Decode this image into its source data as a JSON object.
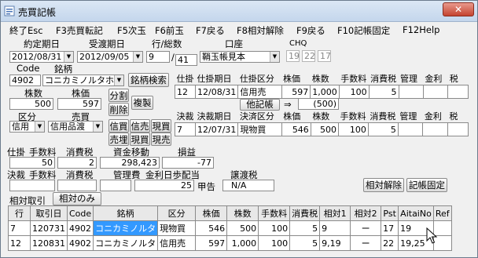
{
  "window": {
    "title": "売買記帳",
    "close_glyph": "✕"
  },
  "menu": [
    "終了Esc",
    "F3売買転記",
    "F5次玉",
    "F6前玉",
    "F7戻る",
    "F8相対解除",
    "F9戻る",
    "F10記帳固定",
    "F12Help"
  ],
  "top": {
    "contract_date_label": "約定期日",
    "contract_date": "2012/08/31",
    "delivery_date_label": "受渡期日",
    "delivery_date": "2012/09/05",
    "row_total_label": "行/総数",
    "row": "9",
    "total": "41",
    "account_label": "口座",
    "account": "鞘玉帳見本",
    "chq_label": "CHQ",
    "chq": [
      "19",
      "22",
      "17"
    ],
    "code_label": "Code",
    "code": "4902",
    "brand_label": "銘柄",
    "brand": "コニカミノルタホー",
    "brand_search_button": "銘柄検索"
  },
  "entry": {
    "shares_label": "株数",
    "shares": "500",
    "price_label": "株価",
    "price": "597",
    "split_button": "分割",
    "delete_button": "削除",
    "copy_button": "複製",
    "category_label": "区分",
    "category": "信用",
    "trade_label": "売買",
    "trade": "信用品渡",
    "btn_credit_buy": "信買",
    "btn_credit_sell": "信売",
    "btn_spot_buy": "現買",
    "btn_spot_sell_a": "売埋",
    "btn_spot_buy2": "現買",
    "btn_spot_sell": "現売"
  },
  "open_position": {
    "headers": [
      "仕掛",
      "仕掛期日",
      "仕掛区分",
      "株価",
      "株数",
      "手数料",
      "消費税",
      "管理",
      "金利",
      "税"
    ],
    "row": [
      "12",
      "12/08/31",
      "信用売",
      "597",
      "1,000",
      "100",
      "5",
      "",
      "",
      ""
    ],
    "other_label": "他記帳",
    "arrow": "⇒",
    "other_value": "(500)"
  },
  "settlement": {
    "headers": [
      "決裁",
      "決裁期日",
      "決済区分",
      "株価",
      "株数",
      "手数料",
      "消費税",
      "管理",
      "金利",
      "税"
    ],
    "row": [
      "7",
      "12/07/31",
      "現物買",
      "546",
      "500",
      "100",
      "5",
      "",
      "",
      ""
    ]
  },
  "summary": {
    "open_label": "仕掛",
    "fee_label": "手数料",
    "tax_label": "消費税",
    "cash_move_label": "資金移動",
    "pl_label": "損益",
    "fee": "50",
    "tax": "2",
    "cash_move": "298,423",
    "pl": "-77",
    "settle_label": "決裁",
    "fee2_label": "手数料",
    "tax2_label": "消費税",
    "mgmt_label": "管理費",
    "interest_label": "金利日歩配当",
    "transfer_label": "譲渡税",
    "interest_value": "25",
    "kouba_label": "甲告",
    "transfer_value": "N/A",
    "relative_release_button": "相対解除",
    "fix_button": "記帳固定"
  },
  "tabs": [
    "相対取引",
    "相対のみ"
  ],
  "list": {
    "headers": [
      "行",
      "取引日",
      "Code",
      "銘柄",
      "区分",
      "株価",
      "株数",
      "手数料",
      "消費税",
      "相対1",
      "相対2",
      "Pst",
      "AitaiNo",
      "Ref"
    ],
    "rows": [
      [
        "7",
        "120731",
        "4902",
        "コニカミノルタ",
        "現物買",
        "546",
        "500",
        "100",
        "5",
        "9",
        "ー",
        "17",
        "19",
        ""
      ],
      [
        "12",
        "120831",
        "4902",
        "コニカミノルタ",
        "信用売",
        "597",
        "1,000",
        "100",
        "5",
        "9,19",
        "ー",
        "22",
        "19,25",
        ""
      ]
    ]
  }
}
